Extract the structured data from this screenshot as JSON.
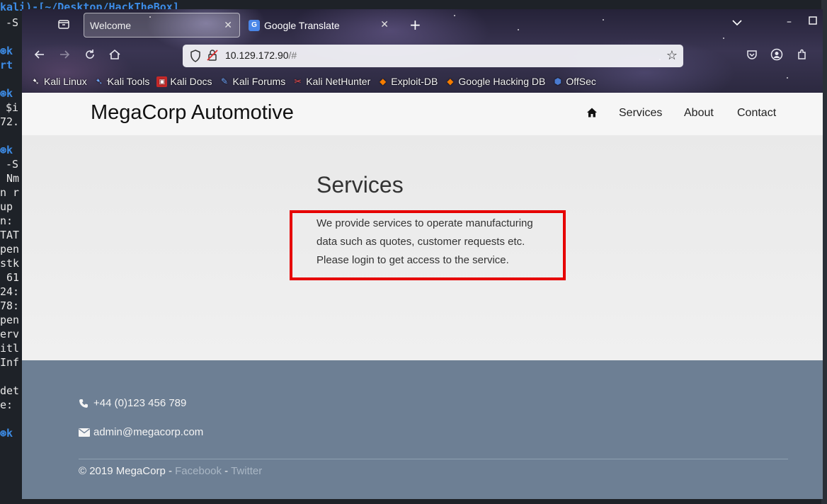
{
  "terminal": {
    "header_text": "kali)-[~/Desktop/HackTheBox]",
    "lines": [
      "-S",
      "k",
      "rt",
      "k",
      "$i",
      "72.",
      "k",
      "-S",
      " Nm",
      "n r",
      "up",
      "n:",
      "TAT",
      "pen",
      "stk",
      " 61",
      "24:",
      "78:",
      "pen",
      "erv",
      "itl",
      "Inf",
      "",
      "det",
      "e:",
      "",
      "k"
    ]
  },
  "browser": {
    "tabs": [
      {
        "title": "Welcome",
        "active": true
      },
      {
        "title": "Google Translate",
        "active": false
      }
    ],
    "url": "10.129.172.90",
    "url_hash": "/#",
    "bookmarks": [
      {
        "label": "Kali Linux",
        "icon": "kali-dragon-icon"
      },
      {
        "label": "Kali Tools",
        "icon": "kali-tools-icon"
      },
      {
        "label": "Kali Docs",
        "icon": "kali-docs-icon"
      },
      {
        "label": "Kali Forums",
        "icon": "kali-forums-icon"
      },
      {
        "label": "Kali NetHunter",
        "icon": "nethunter-icon"
      },
      {
        "label": "Exploit-DB",
        "icon": "exploit-db-icon"
      },
      {
        "label": "Google Hacking DB",
        "icon": "ghdb-icon"
      },
      {
        "label": "OffSec",
        "icon": "offsec-icon"
      }
    ]
  },
  "site": {
    "brand": "MegaCorp Automotive",
    "nav": [
      "Services",
      "About",
      "Contact"
    ],
    "services_title": "Services",
    "services_line1": "We provide services to operate manufacturing",
    "services_line2": "data such as quotes, customer requests etc.",
    "services_line3": "Please login to get access to the service.",
    "phone": "+44 (0)123 456 789",
    "email": "admin@megacorp.com",
    "copyright": "© 2019 MegaCorp - ",
    "sep": " - ",
    "facebook": "Facebook",
    "twitter": "Twitter"
  },
  "colors": {
    "highlight_box": "#e60000",
    "footer_bg": "#6d7f94",
    "terminal_accent": "#3d8ce6"
  }
}
